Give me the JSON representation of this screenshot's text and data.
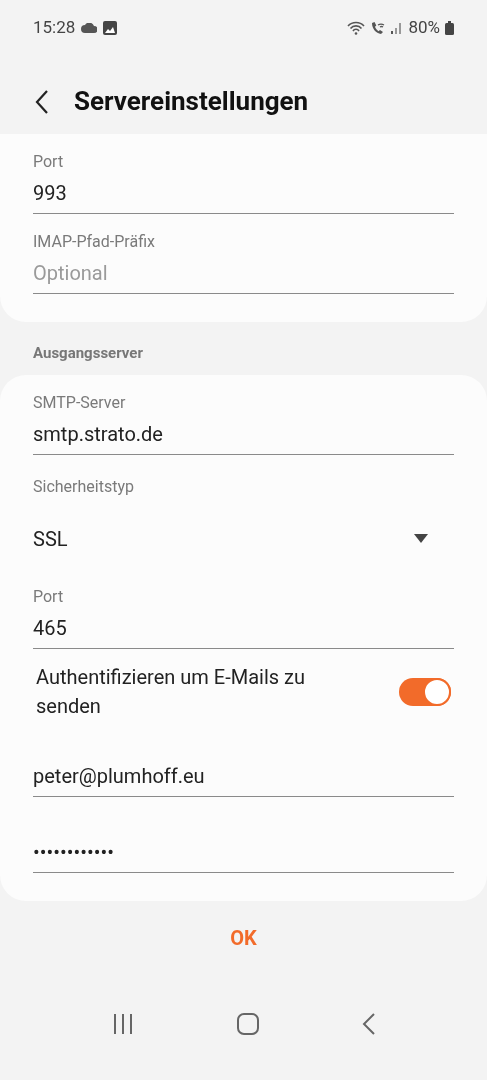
{
  "status_bar": {
    "time": "15:28",
    "battery": "80%"
  },
  "header": {
    "title": "Servereinstellungen"
  },
  "incoming": [
    {
      "kind": "text",
      "label": "Port",
      "value": "993"
    },
    {
      "kind": "text",
      "label": "IMAP-Pfad-Präfix",
      "placeholder": "Optional"
    }
  ],
  "outgoing": {
    "title": "Ausgangsserver",
    "items": [
      {
        "kind": "text",
        "label": "SMTP-Server",
        "value": "smtp.strato.de"
      },
      {
        "kind": "dropdown",
        "label": "Sicherheitstyp",
        "value": "SSL"
      },
      {
        "kind": "text",
        "label": "Port",
        "value": "465"
      },
      {
        "kind": "toggle",
        "label": "Authentifizieren um E-Mails zu senden",
        "on": true
      },
      {
        "kind": "text",
        "value": "peter@plumhoff.eu"
      },
      {
        "kind": "text",
        "value": "••••••••••••"
      }
    ]
  },
  "ok_button": "OK"
}
